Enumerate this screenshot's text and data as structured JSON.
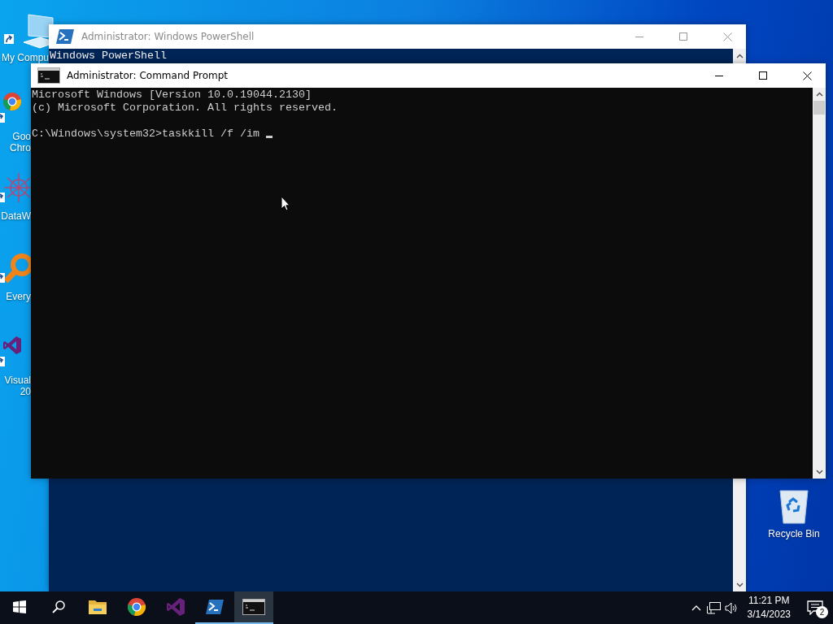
{
  "desktop_icons": [
    {
      "kind": "computer",
      "lines": [
        "My Compu"
      ]
    },
    {
      "kind": "chrome",
      "lines": [
        "Goo",
        "Chro"
      ]
    },
    {
      "kind": "datawizard",
      "lines": [
        "DataW"
      ]
    },
    {
      "kind": "everything",
      "lines": [
        "Every"
      ]
    },
    {
      "kind": "visualstudio",
      "lines": [
        "Visual",
        "20"
      ]
    }
  ],
  "recycle_bin": {
    "label": "Recycle Bin"
  },
  "windows": [
    {
      "kind": "powershell",
      "title": "Administrator: Windows PowerShell",
      "active": false,
      "lines": [
        "Windows PowerShell"
      ]
    },
    {
      "kind": "cmd",
      "title": "Administrator:  Command Prompt",
      "active": true,
      "lines": [
        "Microsoft Windows [Version 10.0.19044.2130]",
        "(c) Microsoft Corporation. All rights reserved."
      ],
      "prompt_line": "C:\\Windows\\system32>taskkill /f /im"
    }
  ],
  "taskbar": {
    "apps": [
      {
        "kind": "explorer",
        "running": false,
        "selected": false
      },
      {
        "kind": "chrome",
        "running": false,
        "selected": false
      },
      {
        "kind": "visualstudio",
        "running": false,
        "selected": false
      },
      {
        "kind": "powershell",
        "running": true,
        "selected": false
      },
      {
        "kind": "cmd",
        "running": true,
        "selected": true
      }
    ],
    "time": "11:21 PM",
    "date": "3/14/2023",
    "notification_count": "2"
  }
}
